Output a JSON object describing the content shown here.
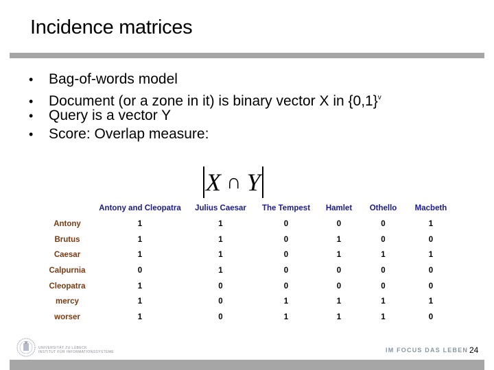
{
  "slide": {
    "title": "Incidence matrices",
    "bullets": [
      {
        "text": "Bag-of-words model",
        "sup": ""
      },
      {
        "text": "Document (or a zone in it) is binary vector X in {0,1}",
        "sup": "v"
      },
      {
        "text": "Query is a vector Y",
        "sup": ""
      },
      {
        "text": "Score: Overlap measure:",
        "sup": ""
      }
    ],
    "bullet_glyph": "•",
    "formula": {
      "left_var": "X",
      "operator": "∩",
      "right_var": "Y"
    },
    "page_number": "24"
  },
  "table": {
    "columns": [
      "Antony and Cleopatra",
      "Julius Caesar",
      "The Tempest",
      "Hamlet",
      "Othello",
      "Macbeth"
    ],
    "rows": [
      {
        "term": "Antony",
        "values": [
          "1",
          "1",
          "0",
          "0",
          "0",
          "1"
        ]
      },
      {
        "term": "Brutus",
        "values": [
          "1",
          "1",
          "0",
          "1",
          "0",
          "0"
        ]
      },
      {
        "term": "Caesar",
        "values": [
          "1",
          "1",
          "0",
          "1",
          "1",
          "1"
        ]
      },
      {
        "term": "Calpurnia",
        "values": [
          "0",
          "1",
          "0",
          "0",
          "0",
          "0"
        ]
      },
      {
        "term": "Cleopatra",
        "values": [
          "1",
          "0",
          "0",
          "0",
          "0",
          "0"
        ]
      },
      {
        "term": "mercy",
        "values": [
          "1",
          "0",
          "1",
          "1",
          "1",
          "1"
        ]
      },
      {
        "term": "worser",
        "values": [
          "1",
          "0",
          "1",
          "1",
          "1",
          "0"
        ]
      }
    ],
    "colors": {
      "header": "#1a1a8c",
      "row_label": "#7a3a10",
      "value": "#000000"
    }
  },
  "footer": {
    "university_line1": "UNIVERSITÄT ZU LÜBECK",
    "university_line2": "INSTITUT FÜR INFORMATIONSSYSTEME",
    "slogan": "IM FOCUS DAS LEBEN",
    "logo_icon": "university-seal-icon"
  }
}
